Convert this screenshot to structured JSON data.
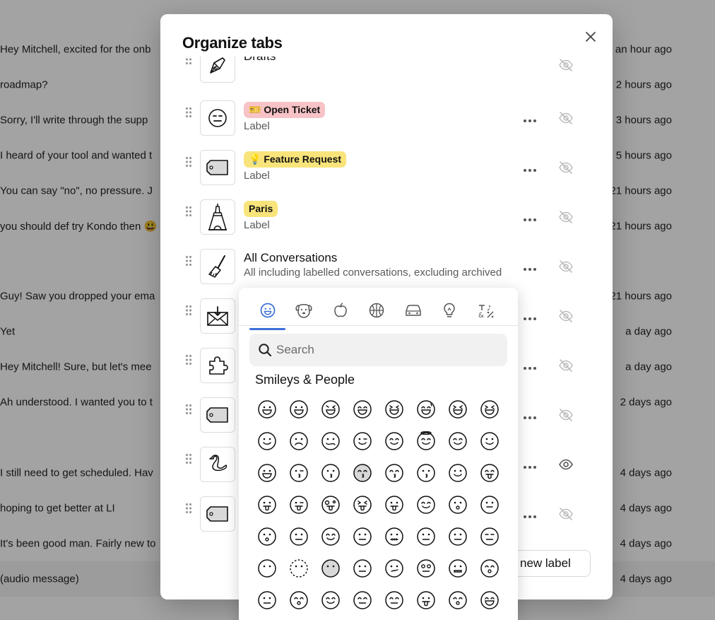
{
  "background_conversations": [
    {
      "message": "Hey Mitchell, excited for the onb",
      "time": "an hour ago"
    },
    {
      "message": "roadmap?",
      "time": "2 hours ago"
    },
    {
      "message": "Sorry, I'll write through the supp",
      "time": "3 hours ago"
    },
    {
      "message": "I heard of your tool and wanted t",
      "time": "5 hours ago"
    },
    {
      "message": "You can say \"no\", no pressure. J",
      "time": "21 hours ago"
    },
    {
      "message": "you should def try Kondo then 😃",
      "time": "21 hours ago"
    },
    {
      "message": "Guy! Saw you dropped your ema",
      "time": "21 hours ago"
    },
    {
      "message": "Yet",
      "time": "a day ago"
    },
    {
      "message": "Hey Mitchell! Sure, but let's mee",
      "time": "a day ago"
    },
    {
      "message": "Ah understood. I wanted you to t",
      "time": "2 days ago"
    },
    {
      "message": "I still need to get scheduled. Hav",
      "time": "4 days ago"
    },
    {
      "message": "hoping to get better at LI",
      "time": "4 days ago"
    },
    {
      "message": "It's been good man. Fairly new to",
      "time": "4 days ago"
    },
    {
      "message": "(audio message)",
      "time": "4 days ago"
    }
  ],
  "modal": {
    "title": "Organize tabs",
    "new_label_button": "new label",
    "tabs": [
      {
        "icon": "pen-icon",
        "title": "Drafts",
        "subtitle": "",
        "visible": false
      },
      {
        "icon": "expressionless-face-icon",
        "badge": "🎫 Open Ticket",
        "badge_color": "#f7c3c6",
        "subtitle": "Label",
        "visible": false
      },
      {
        "icon": "tag-icon",
        "badge": "💡 Feature Request",
        "badge_color": "#f8e47a",
        "subtitle": "Label",
        "visible": false
      },
      {
        "icon": "eiffel-tower-icon",
        "badge": "Paris",
        "badge_color": "#f8e47a",
        "subtitle": "Label",
        "visible": false
      },
      {
        "icon": "broom-icon",
        "title": "All Conversations",
        "subtitle": "All including labelled conversations, excluding archived",
        "visible": false
      },
      {
        "icon": "envelope-download-icon",
        "visible": false
      },
      {
        "icon": "puzzle-piece-icon",
        "visible": false
      },
      {
        "icon": "tag-icon",
        "visible": false
      },
      {
        "icon": "swan-icon",
        "visible": true
      },
      {
        "icon": "tag-icon",
        "visible": false
      }
    ]
  },
  "emoji_picker": {
    "categories": [
      "smiley-icon",
      "dog-face-icon",
      "apple-icon",
      "basketball-icon",
      "car-icon",
      "lightbulb-icon",
      "symbols-icon"
    ],
    "active_category": "smiley-icon",
    "search": {
      "value": "",
      "placeholder": "Search"
    },
    "section_title": "Smileys & People",
    "emojis": [
      "😀",
      "😃",
      "😄",
      "😁",
      "😆",
      "😅",
      "🤣",
      "😂",
      "🙂",
      "🙃",
      "🫠",
      "😉",
      "😊",
      "😇",
      "🥰",
      "😍",
      "🤩",
      "😘",
      "😗",
      "☺️",
      "😚",
      "😙",
      "🥲",
      "😋",
      "😛",
      "😜",
      "🤪",
      "😝",
      "🤑",
      "🤗",
      "🤭",
      "🫢",
      "🫣",
      "🤫",
      "🤔",
      "🫡",
      "🤐",
      "🤨",
      "😐",
      "😑",
      "😶",
      "🫥",
      "😶",
      "😶‍🌫️",
      "😏",
      "😒",
      "🙄",
      "😬",
      "🤥",
      "😌",
      "😔",
      "😪",
      "🤤",
      "😴",
      "😷",
      "🤒"
    ]
  },
  "colors": {
    "accent": "#3a6fd8",
    "overlay": "rgba(0,0,0,0.36)"
  }
}
